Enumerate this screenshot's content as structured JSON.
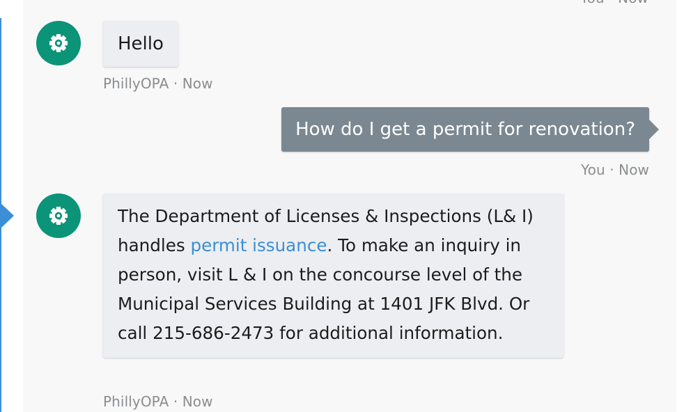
{
  "messages": [
    {
      "sender": "user",
      "meta": {
        "sender": "You",
        "sep": " · ",
        "time": "Now"
      }
    },
    {
      "sender": "bot",
      "text": "Hello",
      "meta": {
        "sender": "PhillyOPA",
        "sep": " · ",
        "time": "Now"
      },
      "avatar_icon": "gear-icon"
    },
    {
      "sender": "user",
      "text": "How do I get a permit for renovation?",
      "meta": {
        "sender": "You",
        "sep": " · ",
        "time": "Now"
      }
    },
    {
      "sender": "bot",
      "text_part1": "The Department of Licenses & Inspections (L& I) handles ",
      "link_text": "permit issuance",
      "text_part2": ". To make an inquiry in person, visit L & I on the concourse level of the Municipal Services Building at 1401 JFK Blvd. Or call 215-686-2473 for additional information.",
      "meta": {
        "sender": "PhillyOPA",
        "sep": " · ",
        "time": "Now"
      },
      "avatar_icon": "gear-icon"
    }
  ],
  "colors": {
    "bot_avatar": "#0b9477",
    "user_bubble": "#7b8891",
    "bot_bubble": "#eceef1",
    "link": "#3a8fd6",
    "accent_rail": "#3a8fd6"
  }
}
